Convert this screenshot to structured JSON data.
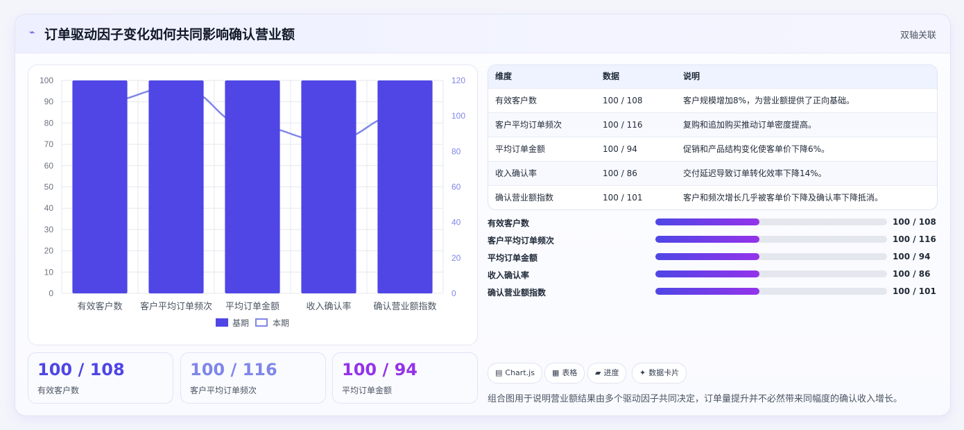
{
  "header": {
    "icon": "trend-icon",
    "icon_glyph": "⌁",
    "title": "订单驱动因子变化如何共同影响确认营业额",
    "tag": "双轴关联"
  },
  "chart_data": {
    "type": "bar",
    "categories": [
      "有效客户数",
      "客户平均订单频次",
      "平均订单金额",
      "收入确认率",
      "确认营业额指数"
    ],
    "series": [
      {
        "name": "基期",
        "type": "bar",
        "axis": "left",
        "values": [
          100,
          100,
          100,
          100,
          100
        ],
        "color": "#4f46e5"
      },
      {
        "name": "本期",
        "type": "line",
        "axis": "right",
        "values": [
          108,
          116,
          94,
          86,
          101
        ],
        "color": "#7f86e8"
      }
    ],
    "y_left": {
      "ticks": [
        "0",
        "10",
        "20",
        "30",
        "40",
        "50",
        "60",
        "70",
        "80",
        "90",
        "100"
      ],
      "range": [
        0,
        100
      ]
    },
    "y_right": {
      "ticks": [
        "0",
        "20",
        "40",
        "60",
        "80",
        "100",
        "120"
      ],
      "range": [
        0,
        120
      ]
    },
    "grid": true,
    "legend": "bottom"
  },
  "stats": [
    {
      "value": "100 / 108",
      "label": "有效客户数",
      "color": "#4f46e5"
    },
    {
      "value": "100 / 116",
      "label": "客户平均订单频次",
      "color": "#7f86e8"
    },
    {
      "value": "100 / 94",
      "label": "平均订单金额",
      "color": "#9333ea"
    }
  ],
  "table": {
    "headers": [
      "维度",
      "数据",
      "说明"
    ],
    "rows": [
      [
        "有效客户数",
        "100 / 108",
        "客户规模增加8%，为营业额提供了正向基础。"
      ],
      [
        "客户平均订单频次",
        "100 / 116",
        "复购和追加购买推动订单密度提高。"
      ],
      [
        "平均订单金额",
        "100 / 94",
        "促销和产品结构变化使客单价下降6%。"
      ],
      [
        "收入确认率",
        "100 / 86",
        "交付延迟导致订单转化效率下降14%。"
      ],
      [
        "确认营业额指数",
        "100 / 101",
        "客户和频次增长几乎被客单价下降及确认率下降抵消。"
      ]
    ]
  },
  "progress": [
    {
      "label": "有效客户数",
      "value": "100 / 108",
      "fill": 0.45
    },
    {
      "label": "客户平均订单频次",
      "value": "100 / 116",
      "fill": 0.45
    },
    {
      "label": "平均订单金额",
      "value": "100 / 94",
      "fill": 0.45
    },
    {
      "label": "收入确认率",
      "value": "100 / 86",
      "fill": 0.45
    },
    {
      "label": "确认营业额指数",
      "value": "100 / 101",
      "fill": 0.45
    }
  ],
  "chips": [
    {
      "icon": "chart-icon",
      "glyph": "▤",
      "label": "Chart.js"
    },
    {
      "icon": "table-icon",
      "glyph": "▦",
      "label": "表格"
    },
    {
      "icon": "progress-icon",
      "glyph": "▰",
      "label": "进度"
    },
    {
      "icon": "sparkle-icon",
      "glyph": "✦",
      "label": "数据卡片"
    }
  ],
  "note": "组合图用于说明营业额结果由多个驱动因子共同决定，订单量提升并不必然带来同幅度的确认收入增长。"
}
